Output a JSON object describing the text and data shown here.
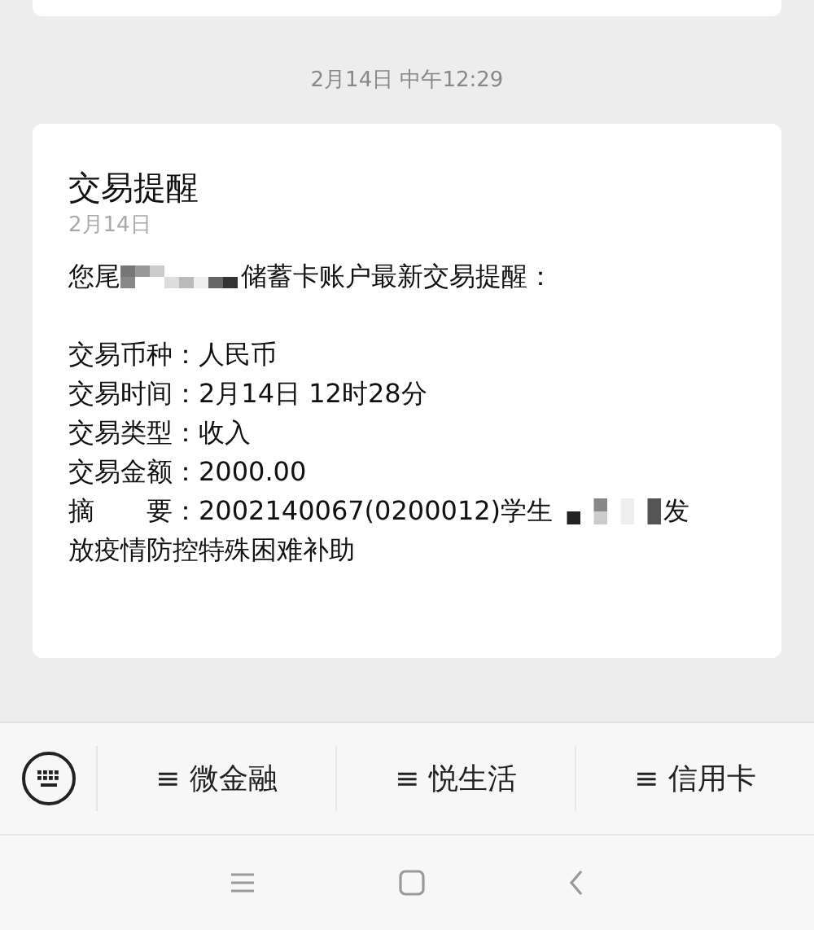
{
  "timestamp": "2月14日 中午12:29",
  "message": {
    "title": "交易提醒",
    "date": "2月14日",
    "intro": {
      "before": "您尾",
      "after": "储蓄卡账户最新交易提醒："
    },
    "details": [
      {
        "kind": "plain",
        "text": "交易币种：人民币"
      },
      {
        "kind": "plain",
        "text": "交易时间：2月14日 12时28分"
      },
      {
        "kind": "plain",
        "text": "交易类型：收入"
      },
      {
        "kind": "plain",
        "text": "交易金额：2000.00"
      },
      {
        "kind": "masked",
        "before": "摘　　要：2002140067(0200012)学生",
        "after": "发"
      },
      {
        "kind": "plain",
        "text": "放疫情防控特殊困难补助"
      }
    ]
  },
  "menu": {
    "items": [
      {
        "label": "≡ 微金融"
      },
      {
        "label": "≡ 悦生活"
      },
      {
        "label": "≡ 信用卡"
      }
    ]
  }
}
